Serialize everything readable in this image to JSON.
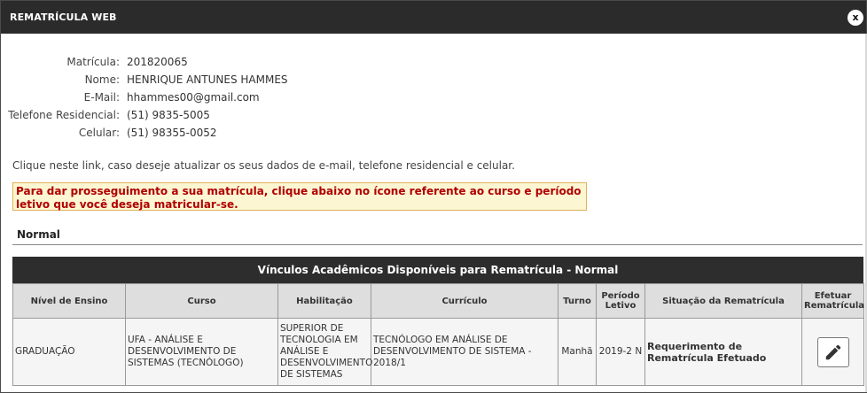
{
  "window": {
    "title": "REMATRÍCULA WEB",
    "close_label": "x"
  },
  "student": {
    "matricula_label": "Matrícula:",
    "matricula": "201820065",
    "nome_label": "Nome:",
    "nome": "HENRIQUE ANTUNES HAMMES",
    "email_label": "E-Mail:",
    "email": "hhammes00@gmail.com",
    "telefone_label": "Telefone Residencial:",
    "telefone": "(51) 9835-5005",
    "celular_label": "Celular:",
    "celular": "(51) 98355-0052"
  },
  "update_link": "Clique neste link, caso deseje atualizar os seus dados de e-mail, telefone residencial e celular.",
  "notice": "Para dar prosseguimento a sua matrícula, clique abaixo no ícone referente ao curso e período letivo que você deseja matricular-se.",
  "section_title": "Normal",
  "table": {
    "title": "Vínculos Acadêmicos Disponíveis para Rematrícula - Normal",
    "headers": {
      "nivel": "Nível de Ensino",
      "curso": "Curso",
      "habilitacao": "Habilitação",
      "curriculo": "Currículo",
      "turno": "Turno",
      "periodo": "Período Letivo",
      "situacao": "Situação da Rematrícula",
      "efetuar": "Efetuar Rematrícula"
    },
    "rows": [
      {
        "nivel": "GRADUAÇÃO",
        "curso": "UFA - ANÁLISE E DESENVOLVIMENTO DE SISTEMAS (TECNÓLOGO)",
        "habilitacao": "SUPERIOR DE TECNOLOGIA EM ANÁLISE E DESENVOLVIMENTO DE SISTEMAS",
        "curriculo": "TECNÓLOGO EM ANÁLISE DE DESENVOLVIMENTO DE SISTEMA - 2018/1",
        "turno": "Manhã",
        "periodo": "2019-2 N",
        "situacao": "Requerimento de Rematrícula Efetuado",
        "action_icon": "edit-pencil-icon"
      }
    ]
  },
  "colors": {
    "titlebar": "#2b2b2b",
    "notice_text": "#b00000",
    "notice_bg": "#fdf6d3",
    "notice_border": "#e0b25a"
  }
}
